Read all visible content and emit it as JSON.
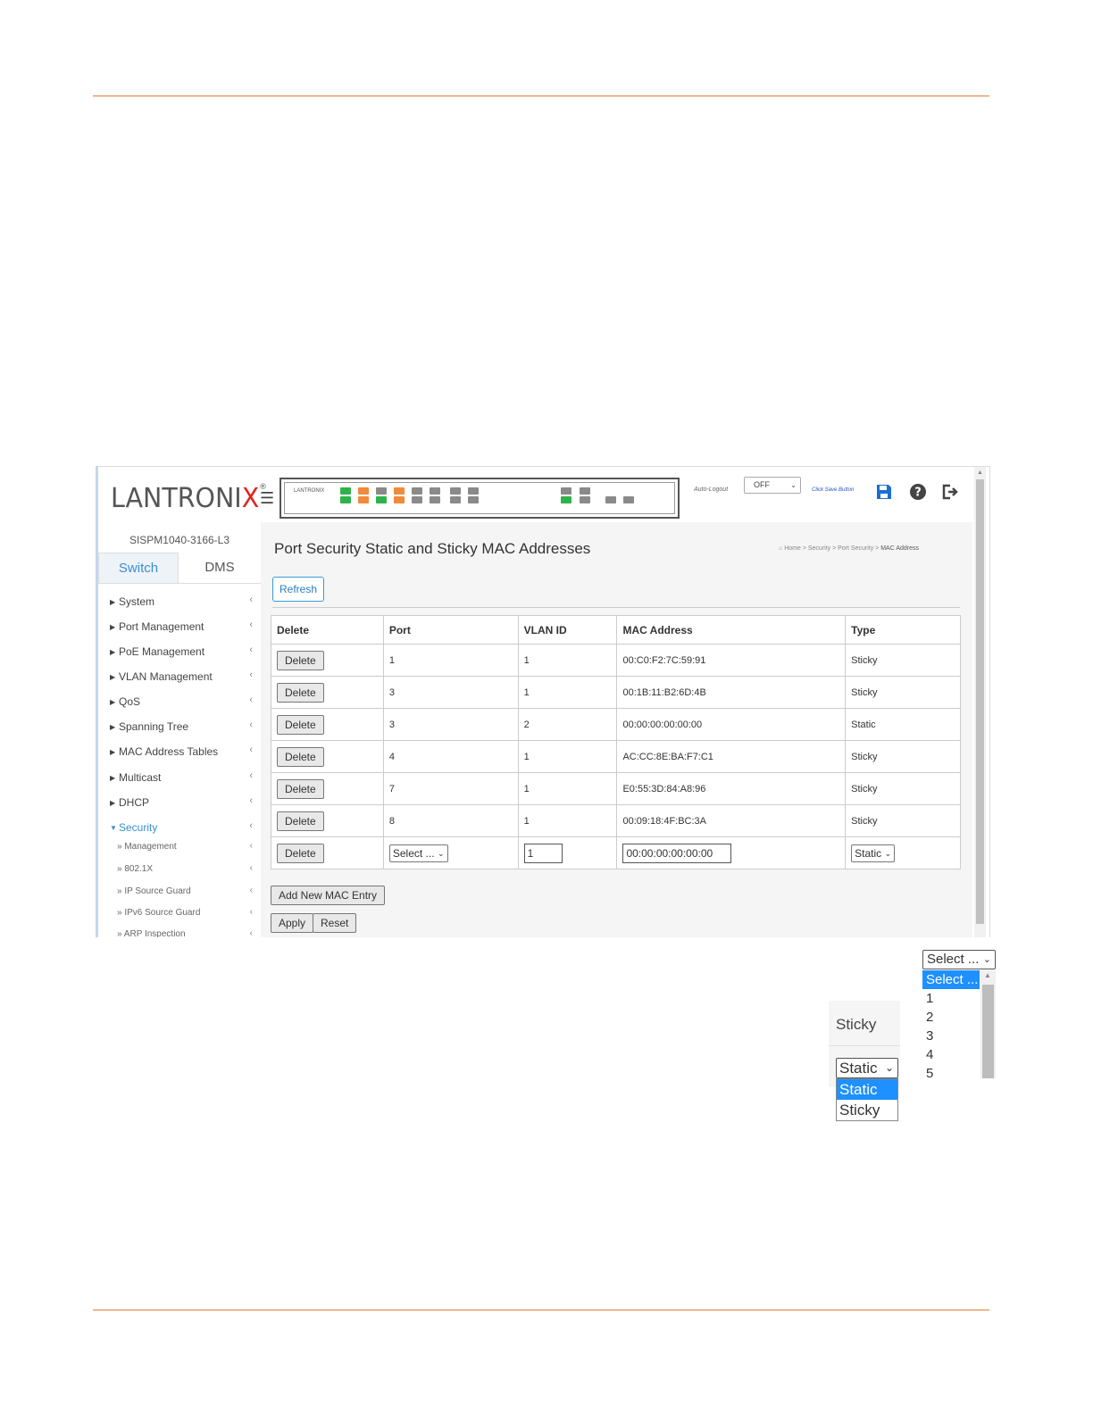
{
  "app": {
    "logo": "LANTRONIX",
    "device_name": "SISPM1040-3166-L3",
    "panel_brand": "LANTRONIX",
    "auto_logout_label": "Auto-Logout",
    "auto_logout_value": "OFF",
    "save_hint": "Click Save Button"
  },
  "tabs": [
    "Switch",
    "DMS"
  ],
  "sidebar": {
    "items": [
      {
        "label": "System"
      },
      {
        "label": "Port Management"
      },
      {
        "label": "PoE Management"
      },
      {
        "label": "VLAN Management"
      },
      {
        "label": "QoS"
      },
      {
        "label": "Spanning Tree"
      },
      {
        "label": "MAC Address Tables"
      },
      {
        "label": "Multicast"
      },
      {
        "label": "DHCP"
      },
      {
        "label": "Security"
      }
    ],
    "security_sub": [
      {
        "label": "Management"
      },
      {
        "label": "802.1X"
      },
      {
        "label": "IP Source Guard"
      },
      {
        "label": "IPv6 Source Guard"
      },
      {
        "label": "ARP Inspection"
      }
    ]
  },
  "page": {
    "title": "Port Security Static and Sticky MAC Addresses",
    "breadcrumb": [
      "Home",
      "Security",
      "Port Security",
      "MAC Address"
    ],
    "refresh_label": "Refresh"
  },
  "table": {
    "headers": [
      "Delete",
      "Port",
      "VLAN ID",
      "MAC Address",
      "Type"
    ],
    "delete_label": "Delete",
    "rows": [
      {
        "port": "1",
        "vlan": "1",
        "mac": "00:C0:F2:7C:59:91",
        "type": "Sticky"
      },
      {
        "port": "3",
        "vlan": "1",
        "mac": "00:1B:11:B2:6D:4B",
        "type": "Sticky"
      },
      {
        "port": "3",
        "vlan": "2",
        "mac": "00:00:00:00:00:00",
        "type": "Static"
      },
      {
        "port": "4",
        "vlan": "1",
        "mac": "AC:CC:8E:BA:F7:C1",
        "type": "Sticky"
      },
      {
        "port": "7",
        "vlan": "1",
        "mac": "E0:55:3D:84:A8:96",
        "type": "Sticky"
      },
      {
        "port": "8",
        "vlan": "1",
        "mac": "00:09:18:4F:BC:3A",
        "type": "Sticky"
      }
    ],
    "new_row": {
      "port_select": "Select ...",
      "vlan_value": "1",
      "mac_value": "00:00:00:00:00:00",
      "type_select": "Static"
    }
  },
  "buttons": {
    "add_new": "Add New MAC Entry",
    "apply": "Apply",
    "reset": "Reset"
  },
  "callout_type": {
    "above_text": "Sticky",
    "select_value": "Static",
    "options": [
      "Static",
      "Sticky"
    ],
    "selected": "Static"
  },
  "callout_port": {
    "select_value": "Select ...",
    "options": [
      "Select ...",
      "1",
      "2",
      "3",
      "4",
      "5"
    ],
    "selected": "Select ..."
  },
  "colors": {
    "accent_rule": "#e07b39",
    "link_blue": "#3a8ed0",
    "selected_option": "#1e90ff",
    "logo_x": "#e2231a",
    "save_icon": "#1a6fd0"
  }
}
